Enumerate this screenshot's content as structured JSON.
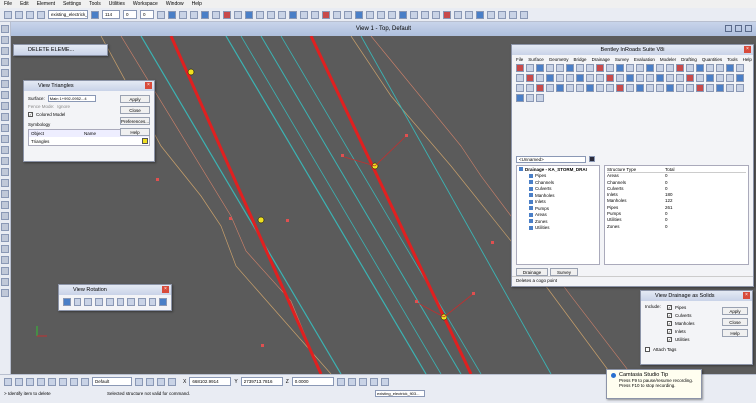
{
  "menu": [
    "File",
    "Edit",
    "Element",
    "Settings",
    "Tools",
    "Utilities",
    "Workspace",
    "Window",
    "Help"
  ],
  "toolbar": {
    "model_combo": "existing_electrick_fi03...",
    "level_combo": "114",
    "level2_combo": "0",
    "style_combo": "0"
  },
  "view": {
    "title": "View 1 - Top, Default"
  },
  "delete_panel": {
    "title": "DELETE ELEME..."
  },
  "view_triangles": {
    "title": "View Triangles",
    "surface_label": "Surface:",
    "surface_value": "Main 1+992-0952...4",
    "fence_mode_label": "Fence Mode:",
    "fence_mode_value": "Ignore",
    "colored_model": "Colored Model",
    "symbology": "Symbology",
    "col_object": "Object",
    "col_name": "Name",
    "row_object": "Triangles",
    "buttons": [
      "Apply",
      "Close",
      "Preferences...",
      "Help"
    ]
  },
  "view_rotation": {
    "title": "View Rotation"
  },
  "inroads": {
    "title": "Bentley InRoads Suite V8i",
    "menu": [
      "File",
      "Surface",
      "Geometry",
      "Bridge",
      "Drainage",
      "Survey",
      "Evaluation",
      "Modeler",
      "Drafting",
      "Quantities",
      "Tools",
      "Help"
    ],
    "unnamed": "<Unnamed>",
    "tree_root": "Drainage - KA_STORM_DRAI",
    "tree_items": [
      "Pipes",
      "Channels",
      "Culverts",
      "Manholes",
      "Inlets",
      "Pumps",
      "Areas",
      "Zones",
      "Utilities"
    ],
    "table_header": [
      "Structure Type",
      "Total"
    ],
    "table_rows": [
      [
        "Areas",
        "0"
      ],
      [
        "Channels",
        "0"
      ],
      [
        "Culverts",
        "0"
      ],
      [
        "Inlets",
        "180"
      ],
      [
        "Manholes",
        "122"
      ],
      [
        "Pipes",
        "261"
      ],
      [
        "Pumps",
        "0"
      ],
      [
        "Utilities",
        "0"
      ],
      [
        "Zones",
        "0"
      ]
    ],
    "tabs": [
      "Drainage",
      "Survey"
    ],
    "status": "Deletes a cogo point"
  },
  "view_drainage": {
    "title": "View Drainage as Solids",
    "include_label": "Include:",
    "items": [
      "Pipes",
      "Culverts",
      "Manholes",
      "Inlets",
      "Utilities"
    ],
    "attach_tags": "Attach Tags",
    "buttons": [
      "Apply",
      "Close",
      "Help"
    ]
  },
  "camtasia": {
    "title": "Camtasia Studio Tip",
    "line1": "Press F9 to pause/resume recording.",
    "line2": "Press F10 to stop recording."
  },
  "statusbar": {
    "default_combo": "Default",
    "x_value": "668102.9914",
    "y_value": "2739713.7816",
    "z_value": "0.0000",
    "prompt": "> Identify item to delete",
    "message": "Selected structure not valid for command.",
    "file_combo": "existing_electrick_fi03..."
  }
}
